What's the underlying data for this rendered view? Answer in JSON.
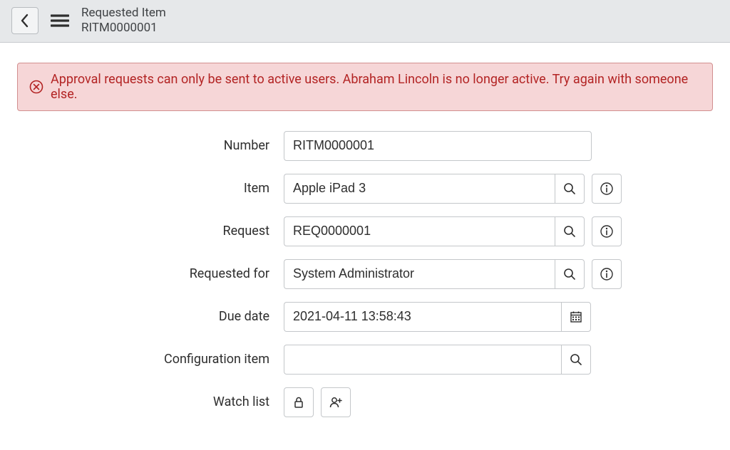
{
  "header": {
    "title": "Requested Item",
    "subtitle": "RITM0000001"
  },
  "alert": {
    "message": "Approval requests can only be sent to active users. Abraham Lincoln is no longer active. Try again with someone else."
  },
  "form": {
    "number": {
      "label": "Number",
      "value": "RITM0000001"
    },
    "item": {
      "label": "Item",
      "value": "Apple iPad 3"
    },
    "request": {
      "label": "Request",
      "value": "REQ0000001"
    },
    "requested_for": {
      "label": "Requested for",
      "value": "System Administrator"
    },
    "due_date": {
      "label": "Due date",
      "value": "2021-04-11 13:58:43"
    },
    "configuration_item": {
      "label": "Configuration item",
      "value": ""
    },
    "watch_list": {
      "label": "Watch list"
    }
  }
}
